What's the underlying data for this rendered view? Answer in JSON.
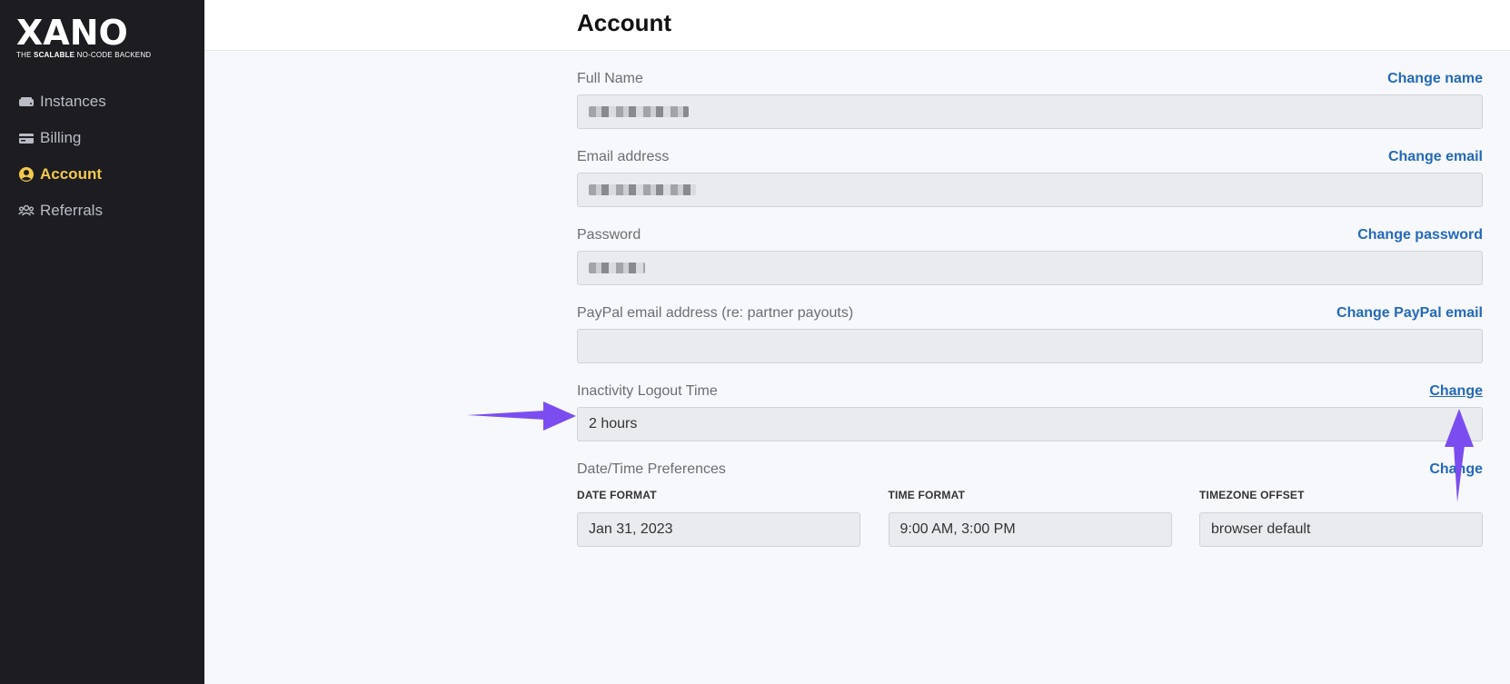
{
  "brand": {
    "name": "XANO",
    "tagline_pre": "THE ",
    "tagline_bold": "SCALABLE",
    "tagline_post": " NO-CODE BACKEND"
  },
  "sidebar": {
    "items": [
      {
        "label": "Instances",
        "icon": "server-icon",
        "active": false
      },
      {
        "label": "Billing",
        "icon": "credit-card-icon",
        "active": false
      },
      {
        "label": "Account",
        "icon": "user-circle-icon",
        "active": true
      },
      {
        "label": "Referrals",
        "icon": "users-icon",
        "active": false
      }
    ]
  },
  "page": {
    "title": "Account"
  },
  "fields": {
    "full_name": {
      "label": "Full Name",
      "action": "Change name"
    },
    "email": {
      "label": "Email address",
      "action": "Change email"
    },
    "password": {
      "label": "Password",
      "action": "Change password"
    },
    "paypal": {
      "label": "PayPal email address (re: partner payouts)",
      "action": "Change PayPal email",
      "value": ""
    },
    "inactivity": {
      "label": "Inactivity Logout Time",
      "action": "Change",
      "value": "2 hours"
    },
    "datetime": {
      "label": "Date/Time Preferences",
      "action": "Change",
      "date_format": {
        "label": "DATE FORMAT",
        "value": "Jan 31, 2023"
      },
      "time_format": {
        "label": "TIME FORMAT",
        "value": "9:00 AM, 3:00 PM"
      },
      "timezone": {
        "label": "TIMEZONE OFFSET",
        "value": "browser default"
      }
    }
  },
  "colors": {
    "sidebar_bg": "#1c1c21",
    "active_nav": "#f2c94c",
    "link": "#2369b8",
    "annotation_arrow": "#7b4df0"
  }
}
